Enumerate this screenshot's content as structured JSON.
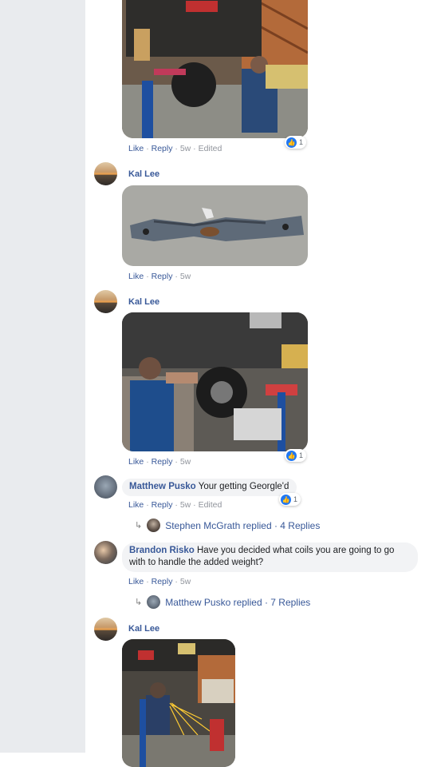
{
  "comments": [
    {
      "author": "",
      "actions": {
        "like": "Like",
        "reply": "Reply",
        "time": "5w",
        "edited": "Edited"
      },
      "reactions": "1"
    },
    {
      "author": "Kal Lee",
      "actions": {
        "like": "Like",
        "reply": "Reply",
        "time": "5w"
      }
    },
    {
      "author": "Kal Lee",
      "actions": {
        "like": "Like",
        "reply": "Reply",
        "time": "5w"
      },
      "reactions": "1"
    },
    {
      "author": "Matthew Pusko",
      "text": "Your getting Georgle'd",
      "actions": {
        "like": "Like",
        "reply": "Reply",
        "time": "5w",
        "edited": "Edited"
      },
      "reactions": "1",
      "replies_summary": "Stephen McGrath replied · 4 Replies"
    },
    {
      "author": "Brandon Risko",
      "text": "Have you decided what coils you are going to go with to handle the added weight?",
      "actions": {
        "like": "Like",
        "reply": "Reply",
        "time": "5w"
      },
      "replies_summary": "Matthew Pusko replied · 7 Replies"
    },
    {
      "author": "Kal Lee"
    }
  ],
  "separator": "·",
  "icons": {
    "like_reaction": "thumbs-up-icon",
    "reply_arrow": "reply-arrow-icon"
  },
  "colors": {
    "link": "#385898",
    "meta": "#90949c",
    "like_blue": "#2078f4",
    "sidebar": "#e9ebee"
  }
}
